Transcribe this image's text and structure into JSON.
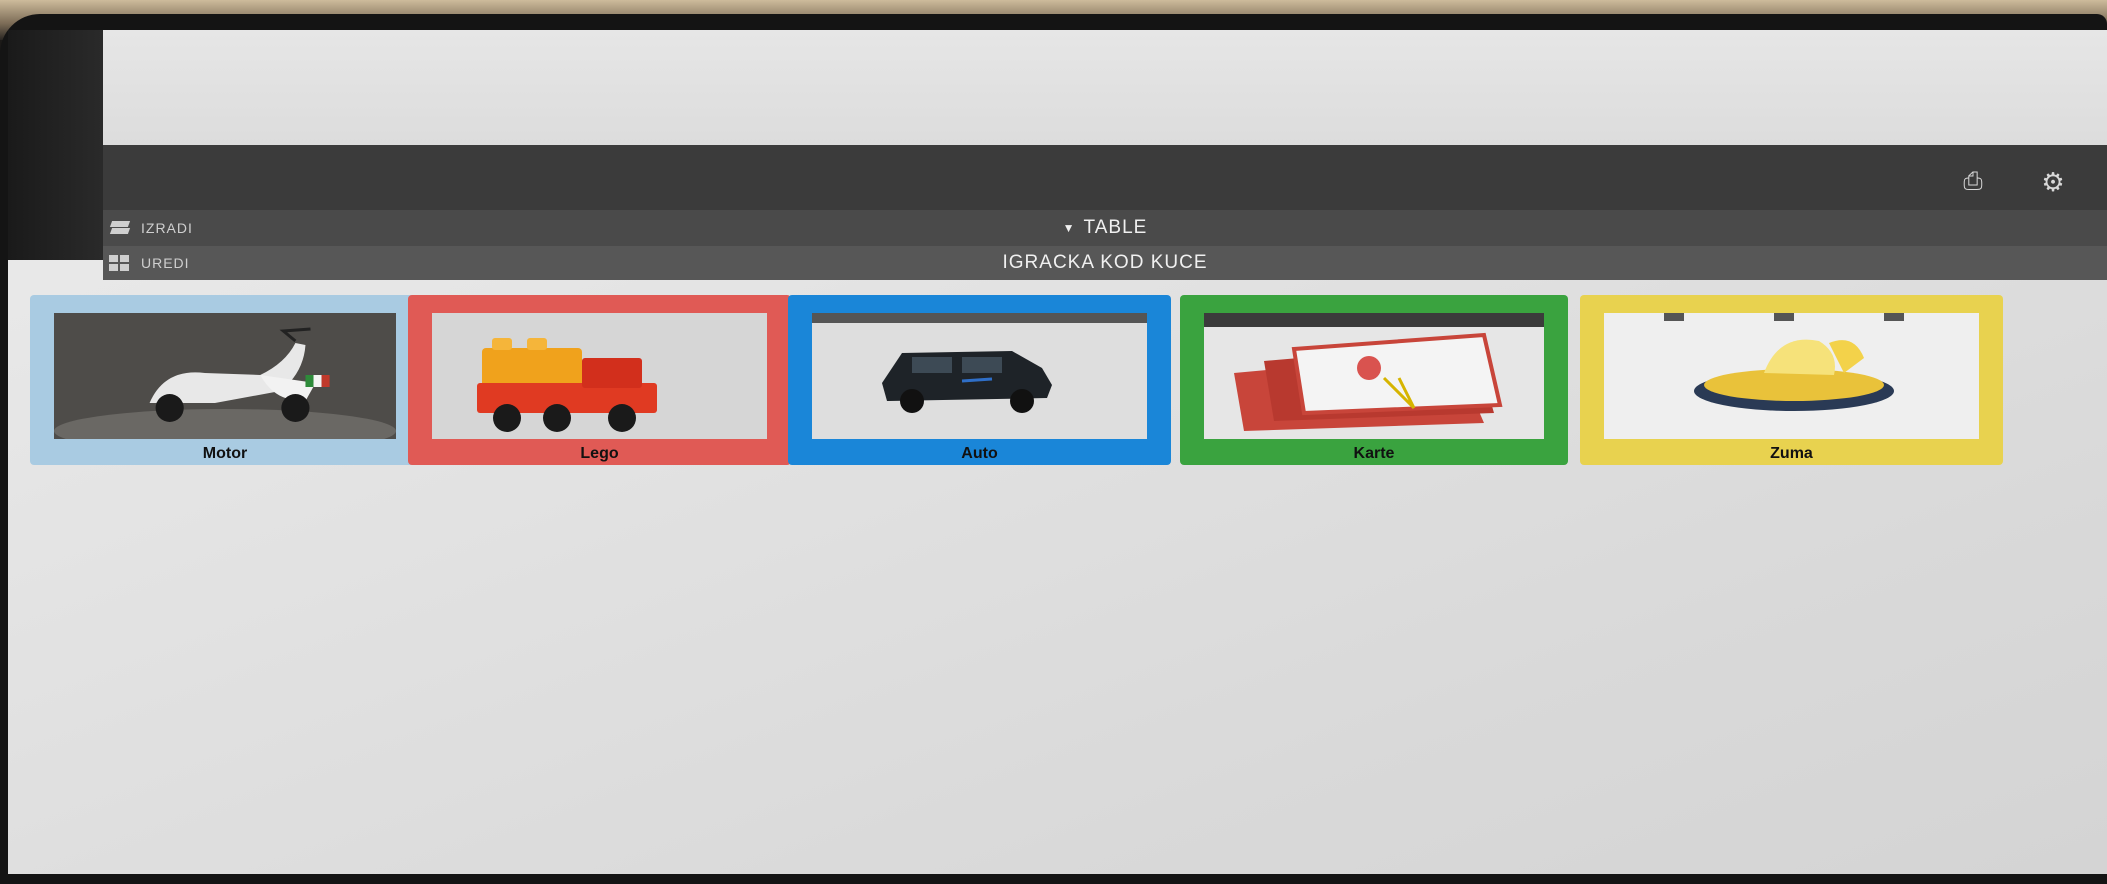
{
  "toolbar": {
    "printer_icon": "printer-icon",
    "settings_icon": "gear-icon"
  },
  "menu": {
    "izradi_label": "IZRADI",
    "uredi_label": "UREDI"
  },
  "header": {
    "dropdown_label": "TABLE",
    "board_title": "IGRACKA KOD KUCE"
  },
  "cards": [
    {
      "label": "Motor",
      "color": "#a9cbe2"
    },
    {
      "label": "Lego",
      "color": "#e05a55"
    },
    {
      "label": "Auto",
      "color": "#1a86d8"
    },
    {
      "label": "Karte",
      "color": "#3aa33f"
    },
    {
      "label": "Zuma",
      "color": "#e8d24f"
    }
  ]
}
